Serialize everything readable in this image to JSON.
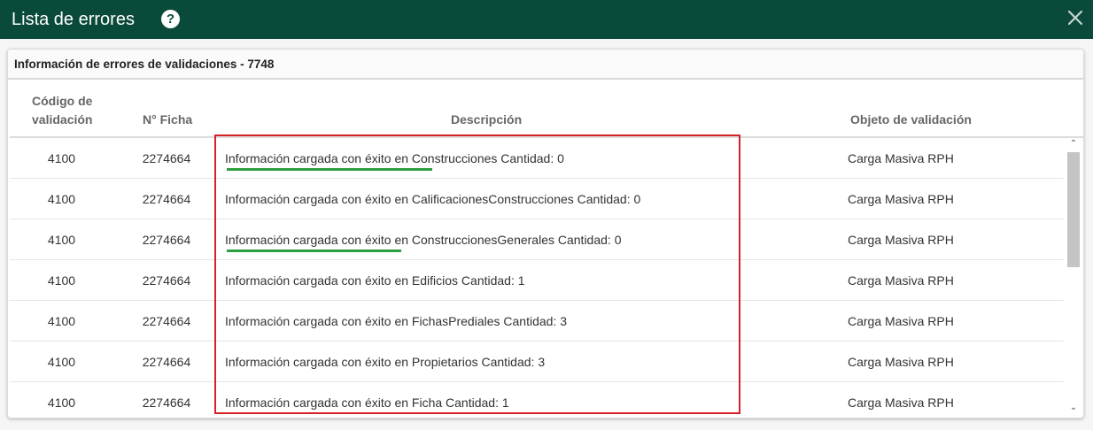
{
  "dialog": {
    "title": "Lista de errores",
    "help_icon": "question-circle-icon",
    "close_icon": "close-x-icon"
  },
  "panel": {
    "header": "Información de errores de validaciones - 7748",
    "columns": {
      "code": "Código de validación",
      "ficha": "N° Ficha",
      "description": "Descripción",
      "object": "Objeto de validación"
    },
    "rows": [
      {
        "code": "4100",
        "ficha": "2274664",
        "description": "Información cargada con éxito en Construcciones Cantidad: 0",
        "object": "Carga Masiva RPH"
      },
      {
        "code": "4100",
        "ficha": "2274664",
        "description": "Información cargada con éxito en CalificacionesConstrucciones Cantidad: 0",
        "object": "Carga Masiva RPH"
      },
      {
        "code": "4100",
        "ficha": "2274664",
        "description": "Información cargada con éxito en ConstruccionesGenerales Cantidad: 0",
        "object": "Carga Masiva RPH"
      },
      {
        "code": "4100",
        "ficha": "2274664",
        "description": "Información cargada con éxito en Edificios Cantidad: 1",
        "object": "Carga Masiva RPH"
      },
      {
        "code": "4100",
        "ficha": "2274664",
        "description": "Información cargada con éxito en FichasPrediales Cantidad: 3",
        "object": "Carga Masiva RPH"
      },
      {
        "code": "4100",
        "ficha": "2274664",
        "description": "Información cargada con éxito en Propietarios Cantidad: 3",
        "object": "Carga Masiva RPH"
      },
      {
        "code": "4100",
        "ficha": "2274664",
        "description": "Información cargada con éxito en Ficha Cantidad: 1",
        "object": "Carga Masiva RPH"
      }
    ]
  },
  "colors": {
    "titlebar": "#0a4a3a",
    "highlight_box": "#d3222a",
    "underline": "#2c9e3f"
  }
}
